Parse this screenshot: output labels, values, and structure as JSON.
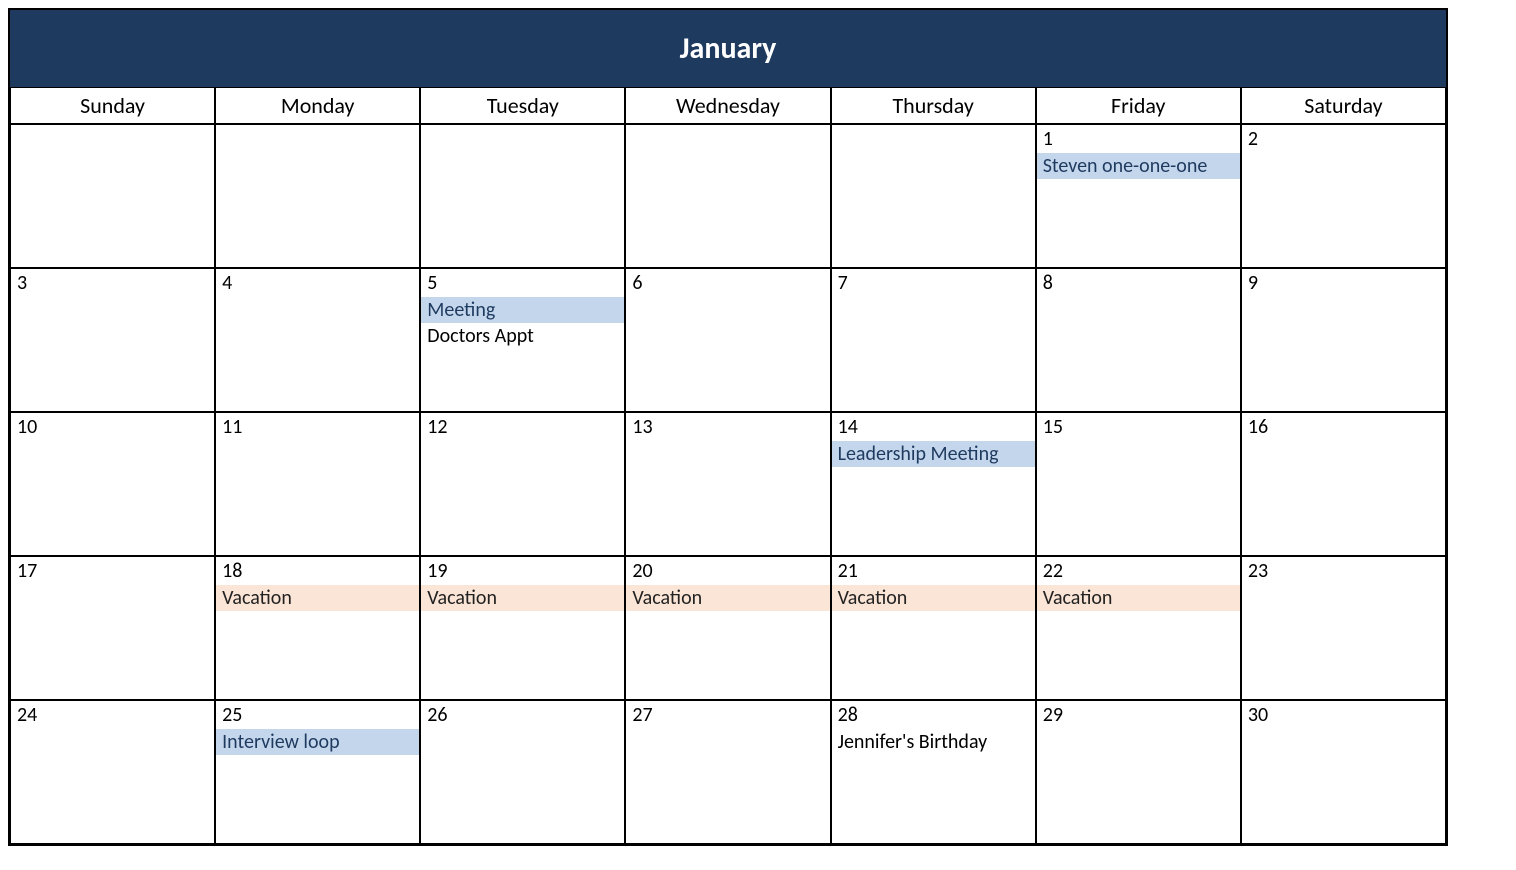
{
  "month": "January",
  "dayHeaders": [
    "Sunday",
    "Monday",
    "Tuesday",
    "Wednesday",
    "Thursday",
    "Friday",
    "Saturday"
  ],
  "eventColors": {
    "blue": "#c3d6ec",
    "peach": "#fbe5d6"
  },
  "weeks": [
    [
      {
        "num": "",
        "events": []
      },
      {
        "num": "",
        "events": []
      },
      {
        "num": "",
        "events": []
      },
      {
        "num": "",
        "events": []
      },
      {
        "num": "",
        "events": []
      },
      {
        "num": "1",
        "events": [
          {
            "label": "Steven one-one-one",
            "color": "blue"
          }
        ]
      },
      {
        "num": "2",
        "events": []
      }
    ],
    [
      {
        "num": "3",
        "events": []
      },
      {
        "num": "4",
        "events": []
      },
      {
        "num": "5",
        "events": [
          {
            "label": "Meeting",
            "color": "blue"
          },
          {
            "label": "Doctors Appt",
            "color": "plain"
          }
        ]
      },
      {
        "num": "6",
        "events": []
      },
      {
        "num": "7",
        "events": []
      },
      {
        "num": "8",
        "events": []
      },
      {
        "num": "9",
        "events": []
      }
    ],
    [
      {
        "num": "10",
        "events": []
      },
      {
        "num": "11",
        "events": []
      },
      {
        "num": "12",
        "events": []
      },
      {
        "num": "13",
        "events": []
      },
      {
        "num": "14",
        "events": [
          {
            "label": "Leadership Meeting",
            "color": "blue"
          }
        ]
      },
      {
        "num": "15",
        "events": []
      },
      {
        "num": "16",
        "events": []
      }
    ],
    [
      {
        "num": "17",
        "events": []
      },
      {
        "num": "18",
        "events": [
          {
            "label": "Vacation",
            "color": "peach"
          }
        ]
      },
      {
        "num": "19",
        "events": [
          {
            "label": "Vacation",
            "color": "peach"
          }
        ]
      },
      {
        "num": "20",
        "events": [
          {
            "label": "Vacation",
            "color": "peach"
          }
        ]
      },
      {
        "num": "21",
        "events": [
          {
            "label": "Vacation",
            "color": "peach"
          }
        ]
      },
      {
        "num": "22",
        "events": [
          {
            "label": "Vacation",
            "color": "peach"
          }
        ]
      },
      {
        "num": "23",
        "events": []
      }
    ],
    [
      {
        "num": "24",
        "events": []
      },
      {
        "num": "25",
        "events": [
          {
            "label": "Interview loop",
            "color": "blue"
          }
        ]
      },
      {
        "num": "26",
        "events": []
      },
      {
        "num": "27",
        "events": []
      },
      {
        "num": "28",
        "events": [
          {
            "label": "Jennifer's Birthday",
            "color": "plain"
          }
        ]
      },
      {
        "num": "29",
        "events": []
      },
      {
        "num": "30",
        "events": []
      }
    ]
  ]
}
